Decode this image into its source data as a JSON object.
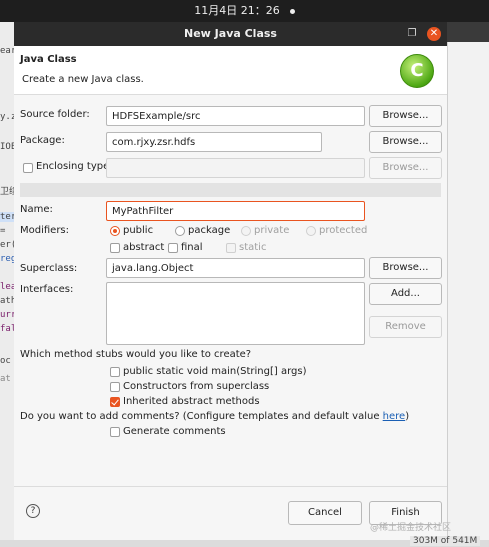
{
  "system": {
    "clock": "11月4日 21：26"
  },
  "background": {
    "left_fragments": [
      "ear",
      "y.z",
      "IOE",
      "卫续",
      "ter",
      "=",
      "er(",
      "reg",
      "lea",
      "ath",
      "urr",
      "fal",
      "oc",
      "at"
    ],
    "memory": "303M of 541M",
    "watermark": "@稀土掘金技术社区"
  },
  "dialog": {
    "window_title": "New Java Class",
    "header_title": "Java Class",
    "header_desc": "Create a new Java class.",
    "source_folder": {
      "label": "Source folder:",
      "value": "HDFSExample/src",
      "button": "Browse..."
    },
    "package": {
      "label": "Package:",
      "value": "com.rjxy.zsr.hdfs",
      "button": "Browse..."
    },
    "enclosing": {
      "label": "Enclosing type:",
      "value": "",
      "button": "Browse..."
    },
    "name": {
      "label": "Name:",
      "value": "MyPathFilter"
    },
    "modifiers": {
      "label": "Modifiers:",
      "radios": [
        "public",
        "package",
        "private",
        "protected"
      ],
      "selected": "public",
      "checks": [
        "abstract",
        "final",
        "static"
      ]
    },
    "superclass": {
      "label": "Superclass:",
      "value": "java.lang.Object",
      "button": "Browse..."
    },
    "interfaces": {
      "label": "Interfaces:",
      "add": "Add...",
      "remove": "Remove"
    },
    "stubs": {
      "question": "Which method stubs would you like to create?",
      "items": [
        {
          "label": "public static void main(String[] args)",
          "checked": false
        },
        {
          "label": "Constructors from superclass",
          "checked": false
        },
        {
          "label": "Inherited abstract methods",
          "checked": true
        }
      ]
    },
    "comments": {
      "question_prefix": "Do you want to add comments? (Configure templates and default value ",
      "link": "here",
      "question_suffix": ")",
      "generate": "Generate comments"
    },
    "help": "?",
    "cancel": "Cancel",
    "finish": "Finish"
  },
  "colors": {
    "accent": "#e95420",
    "title_bar": "#2b2b2b",
    "link": "#1a5fb4"
  }
}
